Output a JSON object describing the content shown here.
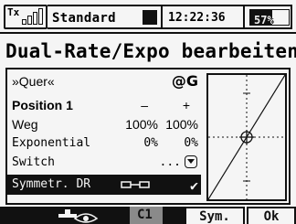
{
  "status": {
    "tx_label": "Tx",
    "model_name": "Standard",
    "time": "12:22:36",
    "battery": "57%",
    "battery_level": 0.57
  },
  "title": "Dual-Rate/Expo bearbeiten",
  "panel": {
    "function_label": "»Quer«",
    "function_icon": "@G",
    "position_label": "Position 1",
    "minus_label": "–",
    "plus_label": "+",
    "rows": [
      {
        "label": "Weg",
        "v1": "100%",
        "v2": "100%"
      },
      {
        "label": "Exponential",
        "v1": "0%",
        "v2": "0%"
      },
      {
        "label": "Switch",
        "v1": "",
        "v2": "..."
      }
    ],
    "selected_label": "Symmetr. DR",
    "selected_check": "✔"
  },
  "softkeys": {
    "c1_label": "C1",
    "sym_label": "Sym.",
    "ok_label": "Ok"
  }
}
